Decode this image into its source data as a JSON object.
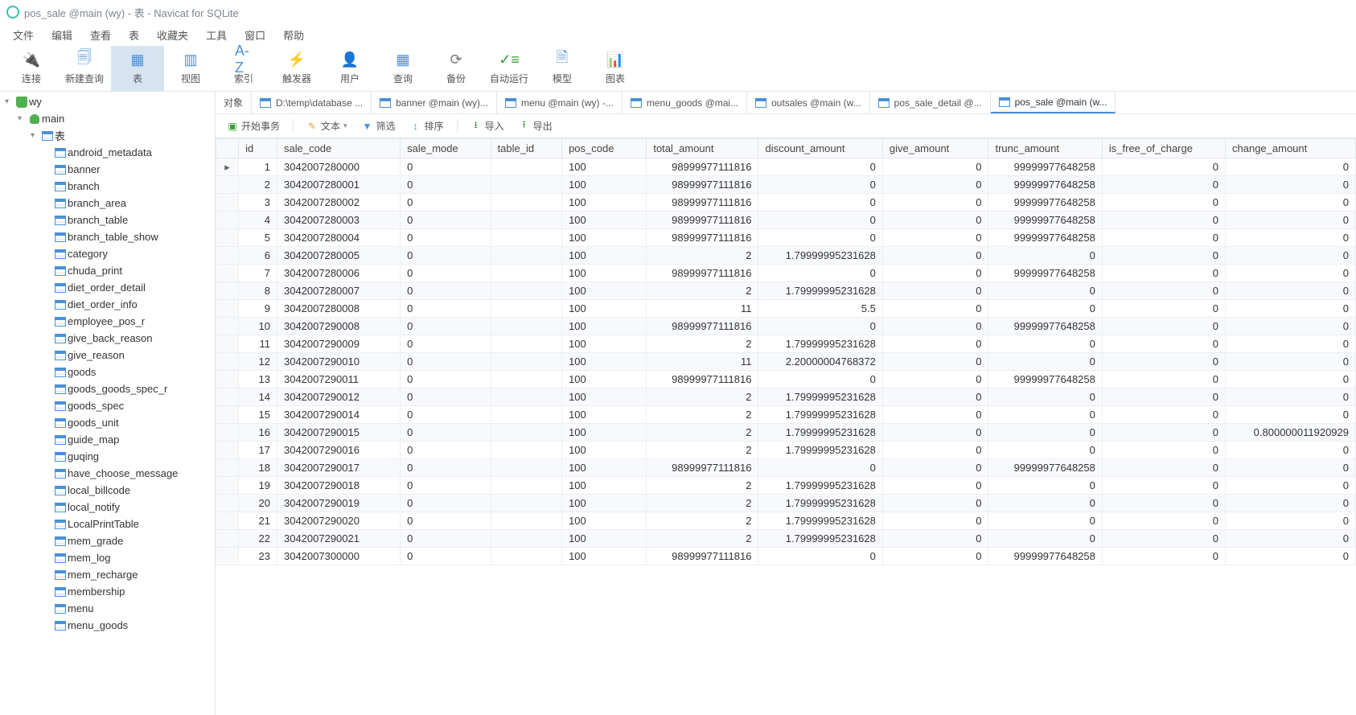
{
  "title": "pos_sale @main (wy) - 表 - Navicat for SQLite",
  "menubar": [
    "文件",
    "编辑",
    "查看",
    "表",
    "收藏夹",
    "工具",
    "窗口",
    "帮助"
  ],
  "toolbar": [
    {
      "label": "连接",
      "icon": "plug"
    },
    {
      "label": "新建查询",
      "icon": "new-query"
    },
    {
      "label": "表",
      "icon": "table",
      "active": true
    },
    {
      "label": "视图",
      "icon": "view"
    },
    {
      "label": "索引",
      "icon": "index"
    },
    {
      "label": "触发器",
      "icon": "trigger"
    },
    {
      "label": "用户",
      "icon": "user"
    },
    {
      "label": "查询",
      "icon": "query"
    },
    {
      "label": "备份",
      "icon": "backup"
    },
    {
      "label": "自动运行",
      "icon": "auto"
    },
    {
      "label": "模型",
      "icon": "model"
    },
    {
      "label": "图表",
      "icon": "chart"
    }
  ],
  "tree": {
    "root": "wy",
    "db": "main",
    "group": "表",
    "tables": [
      "android_metadata",
      "banner",
      "branch",
      "branch_area",
      "branch_table",
      "branch_table_show",
      "category",
      "chuda_print",
      "diet_order_detail",
      "diet_order_info",
      "employee_pos_r",
      "give_back_reason",
      "give_reason",
      "goods",
      "goods_goods_spec_r",
      "goods_spec",
      "goods_unit",
      "guide_map",
      "guqing",
      "have_choose_message",
      "local_billcode",
      "local_notify",
      "LocalPrintTable",
      "mem_grade",
      "mem_log",
      "mem_recharge",
      "membership",
      "menu",
      "menu_goods"
    ]
  },
  "tabs": [
    {
      "label": "对象",
      "type": "plain"
    },
    {
      "label": "D:\\temp\\database ...",
      "type": "table"
    },
    {
      "label": "banner @main (wy)...",
      "type": "table"
    },
    {
      "label": "menu @main (wy) -...",
      "type": "table"
    },
    {
      "label": "menu_goods @mai...",
      "type": "table"
    },
    {
      "label": "outsales @main (w...",
      "type": "table"
    },
    {
      "label": "pos_sale_detail @...",
      "type": "table"
    },
    {
      "label": "pos_sale @main (w...",
      "type": "table",
      "active": true
    }
  ],
  "subtoolbar": {
    "begin_tx": "开始事务",
    "text": "文本",
    "filter": "筛选",
    "sort": "排序",
    "import": "导入",
    "export": "导出"
  },
  "columns": [
    "id",
    "sale_code",
    "sale_mode",
    "table_id",
    "pos_code",
    "total_amount",
    "discount_amount",
    "give_amount",
    "trunc_amount",
    "is_free_of_charge",
    "change_amount"
  ],
  "rows": [
    {
      "id": 1,
      "sale_code": "3042007280000",
      "sale_mode": "0",
      "table_id": "",
      "pos_code": "100",
      "total_amount": "98999977111816",
      "discount_amount": "0",
      "give_amount": "",
      "trunc_amount": "0",
      "is_free_of_charge": "99999977648258",
      "change_amount_label": "0",
      "extra": "0"
    },
    {
      "id": 2,
      "sale_code": "3042007280001",
      "sale_mode": "0",
      "table_id": "",
      "pos_code": "100",
      "total_amount": "98999977111816",
      "discount_amount": "0",
      "give_amount": "",
      "trunc_amount": "0",
      "is_free_of_charge": "99999977648258",
      "change_amount_label": "0",
      "extra": "0"
    },
    {
      "id": 3,
      "sale_code": "3042007280002",
      "sale_mode": "0",
      "table_id": "",
      "pos_code": "100",
      "total_amount": "98999977111816",
      "discount_amount": "0",
      "give_amount": "",
      "trunc_amount": "0",
      "is_free_of_charge": "99999977648258",
      "change_amount_label": "0",
      "extra": "0"
    },
    {
      "id": 4,
      "sale_code": "3042007280003",
      "sale_mode": "0",
      "table_id": "",
      "pos_code": "100",
      "total_amount": "98999977111816",
      "discount_amount": "0",
      "give_amount": "",
      "trunc_amount": "0",
      "is_free_of_charge": "99999977648258",
      "change_amount_label": "0",
      "extra": "0"
    },
    {
      "id": 5,
      "sale_code": "3042007280004",
      "sale_mode": "0",
      "table_id": "",
      "pos_code": "100",
      "total_amount": "98999977111816",
      "discount_amount": "0",
      "give_amount": "",
      "trunc_amount": "0",
      "is_free_of_charge": "99999977648258",
      "change_amount_label": "0",
      "extra": "0"
    },
    {
      "id": 6,
      "sale_code": "3042007280005",
      "sale_mode": "0",
      "table_id": "",
      "pos_code": "100",
      "total_amount": "2",
      "discount_amount": "1.79999995231628",
      "give_amount": "",
      "trunc_amount": "0",
      "is_free_of_charge": "0",
      "change_amount_label": "0",
      "extra": "0"
    },
    {
      "id": 7,
      "sale_code": "3042007280006",
      "sale_mode": "0",
      "table_id": "",
      "pos_code": "100",
      "total_amount": "98999977111816",
      "discount_amount": "0",
      "give_amount": "",
      "trunc_amount": "0",
      "is_free_of_charge": "99999977648258",
      "change_amount_label": "0",
      "extra": "0"
    },
    {
      "id": 8,
      "sale_code": "3042007280007",
      "sale_mode": "0",
      "table_id": "",
      "pos_code": "100",
      "total_amount": "2",
      "discount_amount": "1.79999995231628",
      "give_amount": "",
      "trunc_amount": "0",
      "is_free_of_charge": "0",
      "change_amount_label": "0",
      "extra": "0"
    },
    {
      "id": 9,
      "sale_code": "3042007280008",
      "sale_mode": "0",
      "table_id": "",
      "pos_code": "100",
      "total_amount": "11",
      "discount_amount": "5.5",
      "give_amount": "",
      "trunc_amount": "0",
      "is_free_of_charge": "0",
      "change_amount_label": "0",
      "extra": "0"
    },
    {
      "id": 10,
      "sale_code": "3042007290008",
      "sale_mode": "0",
      "table_id": "",
      "pos_code": "100",
      "total_amount": "98999977111816",
      "discount_amount": "0",
      "give_amount": "",
      "trunc_amount": "0",
      "is_free_of_charge": "99999977648258",
      "change_amount_label": "0",
      "extra": "0"
    },
    {
      "id": 11,
      "sale_code": "3042007290009",
      "sale_mode": "0",
      "table_id": "",
      "pos_code": "100",
      "total_amount": "2",
      "discount_amount": "1.79999995231628",
      "give_amount": "",
      "trunc_amount": "0",
      "is_free_of_charge": "0",
      "change_amount_label": "0",
      "extra": "0"
    },
    {
      "id": 12,
      "sale_code": "3042007290010",
      "sale_mode": "0",
      "table_id": "",
      "pos_code": "100",
      "total_amount": "11",
      "discount_amount": "2.20000004768372",
      "give_amount": "",
      "trunc_amount": "0",
      "is_free_of_charge": "0",
      "change_amount_label": "0",
      "extra": "0"
    },
    {
      "id": 13,
      "sale_code": "3042007290011",
      "sale_mode": "0",
      "table_id": "",
      "pos_code": "100",
      "total_amount": "98999977111816",
      "discount_amount": "0",
      "give_amount": "",
      "trunc_amount": "0",
      "is_free_of_charge": "99999977648258",
      "change_amount_label": "0",
      "extra": "0"
    },
    {
      "id": 14,
      "sale_code": "3042007290012",
      "sale_mode": "0",
      "table_id": "",
      "pos_code": "100",
      "total_amount": "2",
      "discount_amount": "1.79999995231628",
      "give_amount": "",
      "trunc_amount": "0",
      "is_free_of_charge": "0",
      "change_amount_label": "0",
      "extra": "0"
    },
    {
      "id": 15,
      "sale_code": "3042007290014",
      "sale_mode": "0",
      "table_id": "",
      "pos_code": "100",
      "total_amount": "2",
      "discount_amount": "1.79999995231628",
      "give_amount": "",
      "trunc_amount": "0",
      "is_free_of_charge": "0",
      "change_amount_label": "0",
      "extra": "0"
    },
    {
      "id": 16,
      "sale_code": "3042007290015",
      "sale_mode": "0",
      "table_id": "",
      "pos_code": "100",
      "total_amount": "2",
      "discount_amount": "1.79999995231628",
      "give_amount": "",
      "trunc_amount": "0",
      "is_free_of_charge": "0",
      "change_amount_label": "0",
      "extra": "0.800000011920929"
    },
    {
      "id": 17,
      "sale_code": "3042007290016",
      "sale_mode": "0",
      "table_id": "",
      "pos_code": "100",
      "total_amount": "2",
      "discount_amount": "1.79999995231628",
      "give_amount": "",
      "trunc_amount": "0",
      "is_free_of_charge": "0",
      "change_amount_label": "0",
      "extra": "0"
    },
    {
      "id": 18,
      "sale_code": "3042007290017",
      "sale_mode": "0",
      "table_id": "",
      "pos_code": "100",
      "total_amount": "98999977111816",
      "discount_amount": "0",
      "give_amount": "",
      "trunc_amount": "0",
      "is_free_of_charge": "99999977648258",
      "change_amount_label": "0",
      "extra": "0"
    },
    {
      "id": 19,
      "sale_code": "3042007290018",
      "sale_mode": "0",
      "table_id": "",
      "pos_code": "100",
      "total_amount": "2",
      "discount_amount": "1.79999995231628",
      "give_amount": "",
      "trunc_amount": "0",
      "is_free_of_charge": "0",
      "change_amount_label": "0",
      "extra": "0"
    },
    {
      "id": 20,
      "sale_code": "3042007290019",
      "sale_mode": "0",
      "table_id": "",
      "pos_code": "100",
      "total_amount": "2",
      "discount_amount": "1.79999995231628",
      "give_amount": "",
      "trunc_amount": "0",
      "is_free_of_charge": "0",
      "change_amount_label": "0",
      "extra": "0"
    },
    {
      "id": 21,
      "sale_code": "3042007290020",
      "sale_mode": "0",
      "table_id": "",
      "pos_code": "100",
      "total_amount": "2",
      "discount_amount": "1.79999995231628",
      "give_amount": "",
      "trunc_amount": "0",
      "is_free_of_charge": "0",
      "change_amount_label": "0",
      "extra": "0"
    },
    {
      "id": 22,
      "sale_code": "3042007290021",
      "sale_mode": "0",
      "table_id": "",
      "pos_code": "100",
      "total_amount": "2",
      "discount_amount": "1.79999995231628",
      "give_amount": "",
      "trunc_amount": "0",
      "is_free_of_charge": "0",
      "change_amount_label": "0",
      "extra": "0"
    },
    {
      "id": 23,
      "sale_code": "3042007300000",
      "sale_mode": "0",
      "table_id": "",
      "pos_code": "100",
      "total_amount": "98999977111816",
      "discount_amount": "0",
      "give_amount": "",
      "trunc_amount": "0",
      "is_free_of_charge": "99999977648258",
      "change_amount_label": "0",
      "extra": "0"
    }
  ],
  "watermark": ""
}
